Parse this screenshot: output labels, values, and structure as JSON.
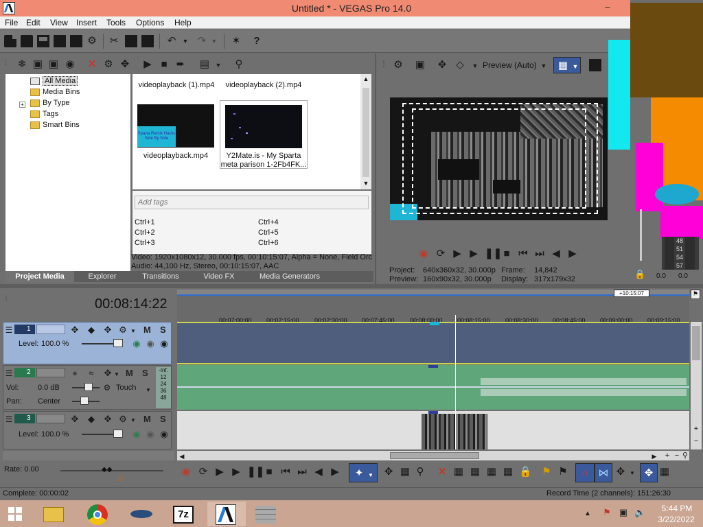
{
  "window": {
    "title": "Untitled * - VEGAS Pro 14.0"
  },
  "menu": [
    "File",
    "Edit",
    "View",
    "Insert",
    "Tools",
    "Options",
    "Help"
  ],
  "media_tree": [
    "All Media",
    "Media Bins",
    "By Type",
    "Tags",
    "Smart Bins"
  ],
  "media_files": {
    "top_row": [
      "videoplayback (1).mp4",
      "videoplayback (2).mp4"
    ],
    "thumb1_label": "videoplayback.mp4",
    "thumb1_overlay": "Sparta Remix Hacks Side By Side",
    "thumb2_label_line1": "Y2Mate.is - My Sparta",
    "thumb2_label_line2": "meta parison 1-2Fb4FK..."
  },
  "tags": {
    "placeholder": "Add tags",
    "shortcuts": [
      "Ctrl+1",
      "Ctrl+4",
      "Ctrl+2",
      "Ctrl+5",
      "Ctrl+3",
      "Ctrl+6"
    ]
  },
  "media_info": {
    "video": "Video: 1920x1080x12, 30.000 fps, 00:10:15:07, Alpha = None, Field Orc",
    "audio": "Audio: 44,100 Hz, Stereo, 00:10:15:07, AAC"
  },
  "tabs": [
    "Project Media",
    "Explorer",
    "Transitions",
    "Video FX",
    "Media Generators"
  ],
  "preview": {
    "mode": "Preview (Auto)",
    "project_label": "Project:",
    "project_value": "640x360x32, 30.000p",
    "preview_label": "Preview:",
    "preview_value": "160x90x32, 30.000p",
    "frame_label": "Frame:",
    "frame_value": "14,842",
    "display_label": "Display:",
    "display_value": "317x179x32"
  },
  "meter": {
    "ticks": [
      "48",
      "51",
      "54",
      "57"
    ],
    "left": "0.0",
    "right": "0.0"
  },
  "timeline": {
    "timecode": "00:08:14:22",
    "duration_badge": "+10:15:07",
    "ruler": [
      "00:07:00:00",
      "00:07:15:00",
      "00:07:30:00",
      "00:07:45:00",
      "00:08:00:00",
      "00:08:15:00",
      "00:08:30:00",
      "00:08:45:00",
      "00:09:00:00",
      "00:09:15:00"
    ],
    "track1": {
      "number": "1",
      "level_label": "Level:",
      "level_value": "100.0 %"
    },
    "track2": {
      "number": "2",
      "vol_label": "Vol:",
      "vol_value": "0.0 dB",
      "pan_label": "Pan:",
      "pan_value": "Center",
      "automation": "Touch",
      "meter_top": "-Inf.",
      "meter_ticks": [
        "12",
        "24",
        "36",
        "48"
      ]
    },
    "track3": {
      "number": "3",
      "level_label": "Level:",
      "level_value": "100.0 %"
    },
    "m_label": "M",
    "s_label": "S"
  },
  "transport": {
    "rate": "Rate: 0.00"
  },
  "status": {
    "complete": "Complete: 00:00:02",
    "record_time": "Record Time (2 channels): 151:26:30"
  },
  "taskbar": {
    "seven_zip": "7z",
    "time": "5:44 PM",
    "date": "3/22/2022"
  }
}
